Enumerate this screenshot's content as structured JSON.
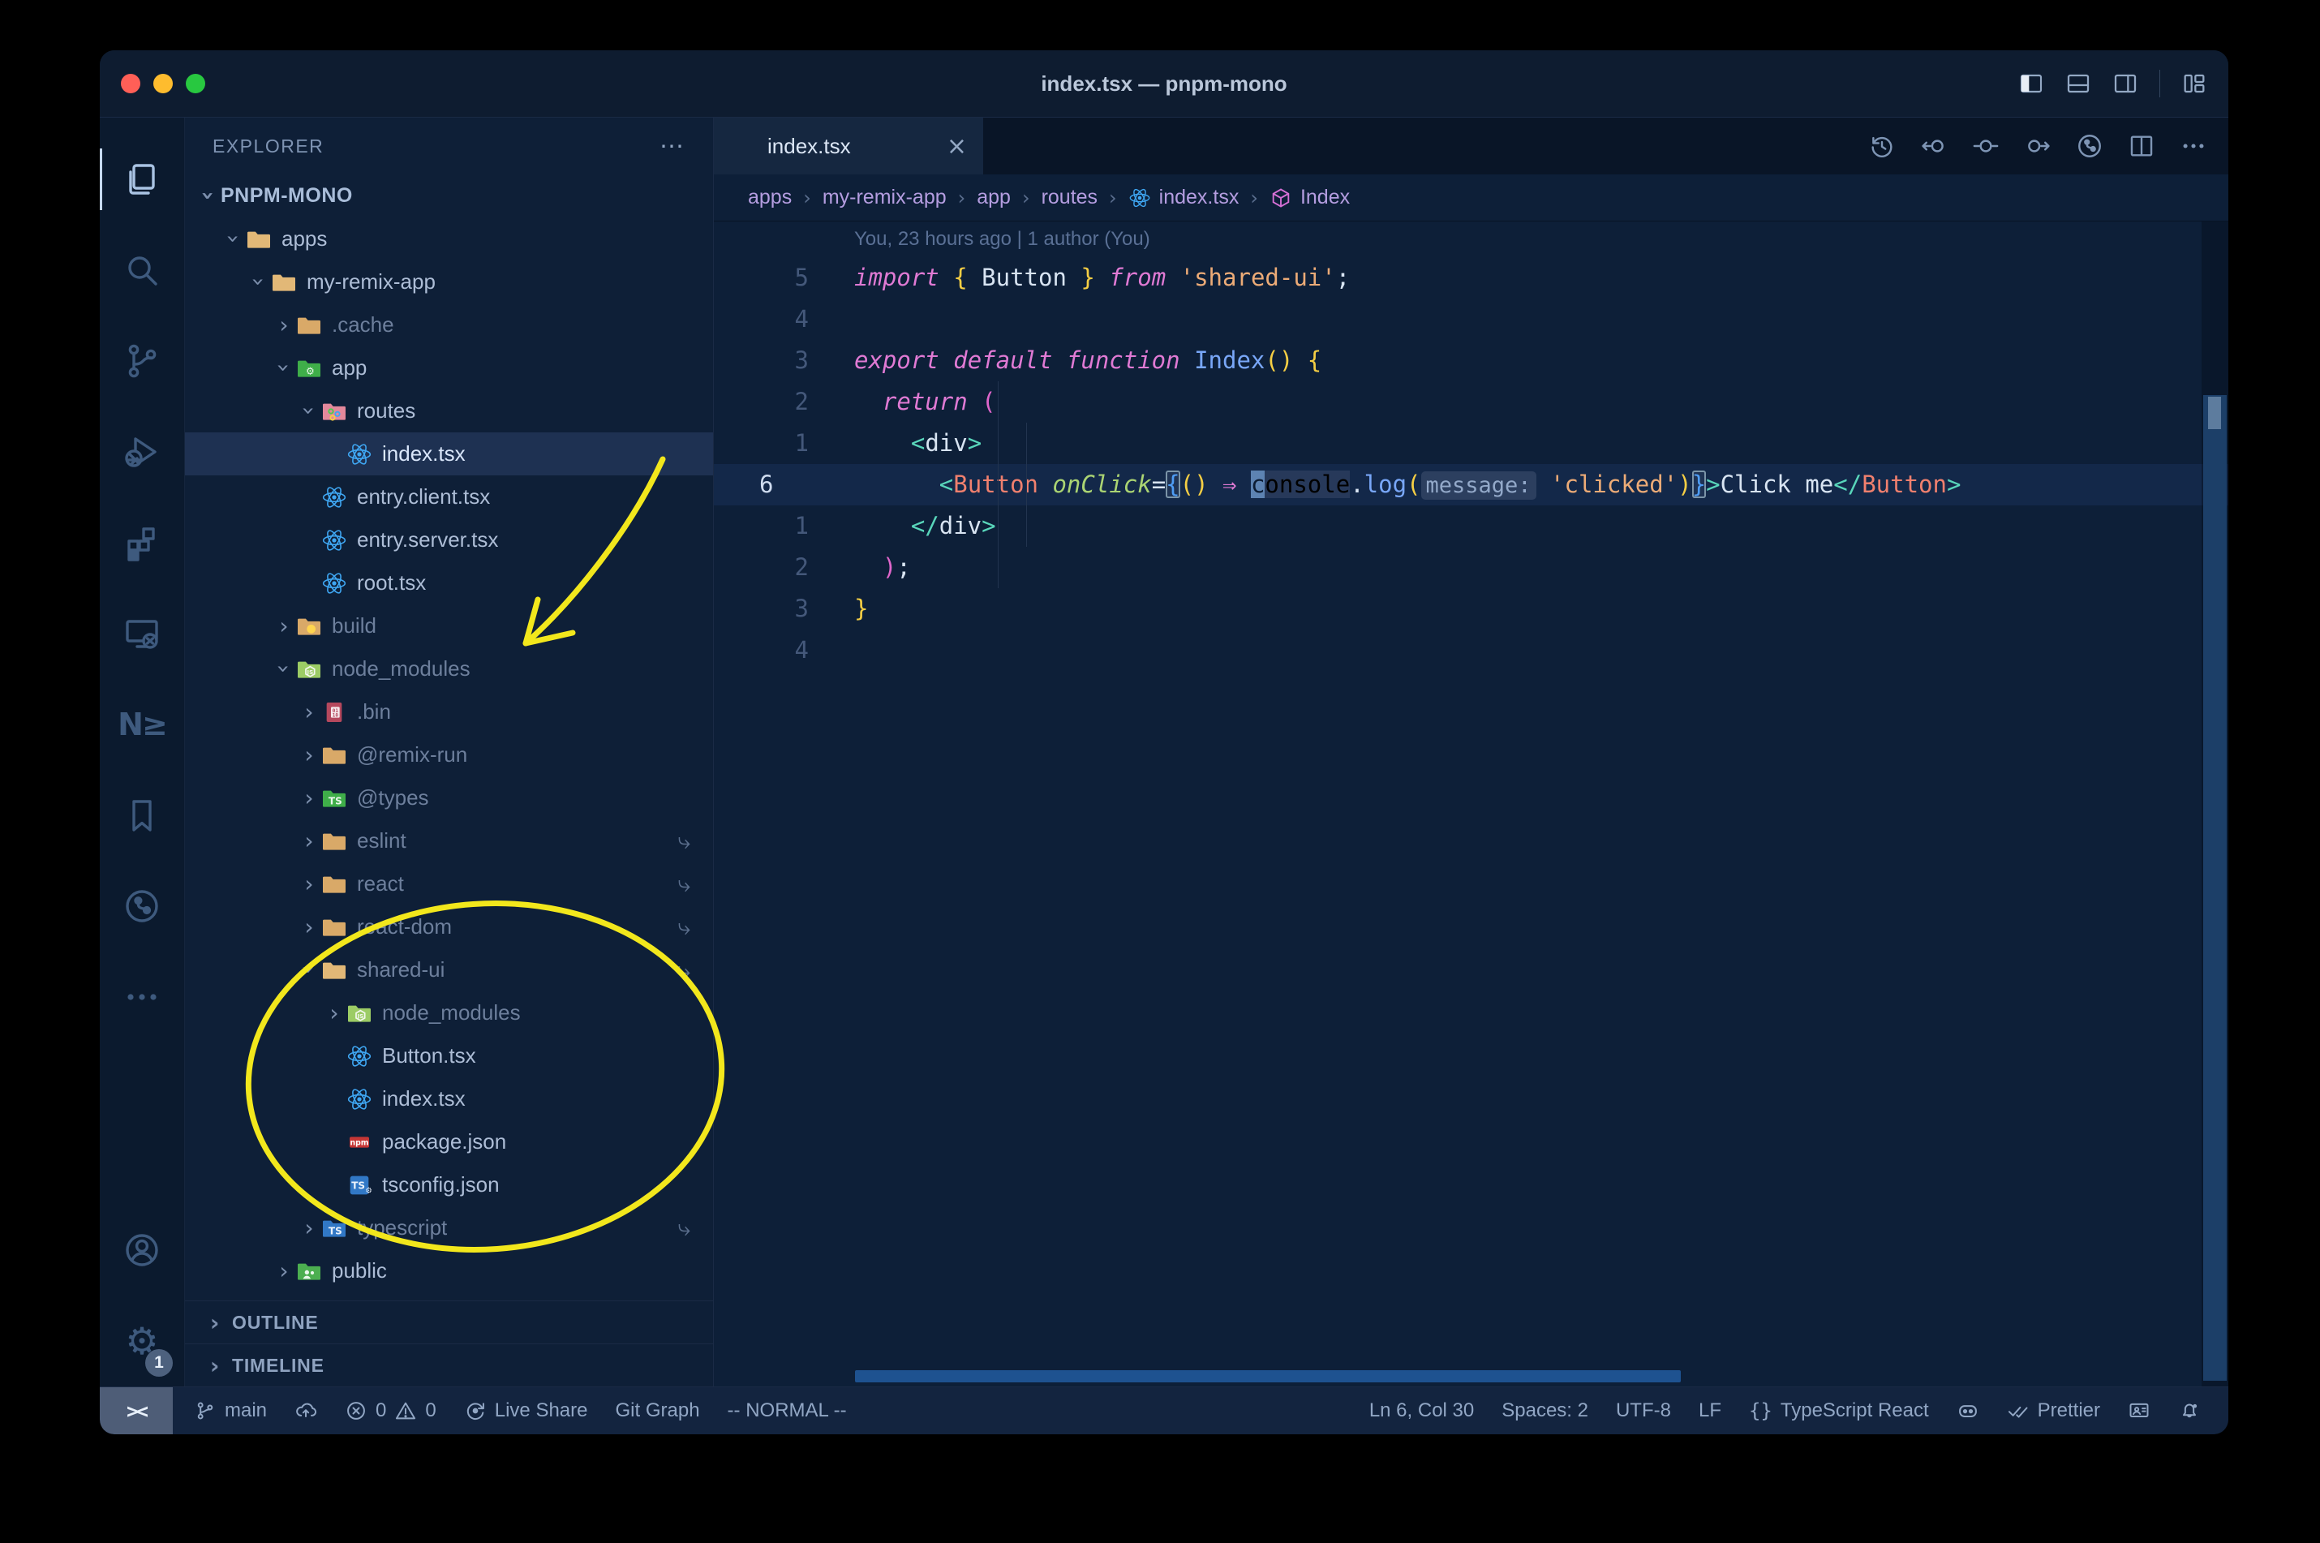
{
  "window": {
    "title": "index.tsx — pnpm-mono"
  },
  "titlebar": {
    "controls": [
      {
        "name": "toggle-primary-sidebar",
        "icon": "layout-sidebar-left"
      },
      {
        "name": "toggle-panel",
        "icon": "layout-panel"
      },
      {
        "name": "toggle-secondary-sidebar",
        "icon": "layout-sidebar-right"
      },
      {
        "name": "customize-layout",
        "icon": "layout-custom"
      }
    ]
  },
  "activity_bar": {
    "top": [
      {
        "name": "explorer",
        "icon": "files",
        "active": true
      },
      {
        "name": "search",
        "icon": "search"
      },
      {
        "name": "source-control",
        "icon": "git-branch-big"
      },
      {
        "name": "run-debug",
        "icon": "debug"
      },
      {
        "name": "extensions",
        "icon": "extensions"
      },
      {
        "name": "remote-explorer",
        "icon": "remote"
      },
      {
        "name": "nx-console",
        "icon": "nx",
        "glyph": "N≥"
      },
      {
        "name": "bookmarks",
        "icon": "bookmark"
      },
      {
        "name": "git-graph",
        "icon": "git-circle"
      },
      {
        "name": "more-views",
        "icon": "ellipsis"
      }
    ],
    "bottom": [
      {
        "name": "accounts",
        "icon": "account"
      },
      {
        "name": "settings",
        "icon": "gear",
        "badge": "1"
      }
    ]
  },
  "sidebar": {
    "header": "EXPLORER",
    "header_more": "⋯",
    "tree": [
      {
        "label": "PNPM-MONO",
        "indent": 0,
        "chevron": "down",
        "root": true
      },
      {
        "label": "apps",
        "indent": 1,
        "chevron": "down",
        "icon": "folder-open"
      },
      {
        "label": "my-remix-app",
        "indent": 2,
        "chevron": "down",
        "icon": "folder-open"
      },
      {
        "label": ".cache",
        "indent": 3,
        "chevron": "right",
        "icon": "folder",
        "dim": true
      },
      {
        "label": "app",
        "indent": 3,
        "chevron": "down",
        "icon": "folder-app"
      },
      {
        "label": "routes",
        "indent": 4,
        "chevron": "down",
        "icon": "folder-routes"
      },
      {
        "label": "index.tsx",
        "indent": 5,
        "icon": "react",
        "selected": true
      },
      {
        "label": "entry.client.tsx",
        "indent": 4,
        "icon": "react"
      },
      {
        "label": "entry.server.tsx",
        "indent": 4,
        "icon": "react"
      },
      {
        "label": "root.tsx",
        "indent": 4,
        "icon": "react"
      },
      {
        "label": "build",
        "indent": 3,
        "chevron": "right",
        "icon": "folder-build",
        "dim": true
      },
      {
        "label": "node_modules",
        "indent": 3,
        "chevron": "down",
        "icon": "folder-node",
        "dim": true
      },
      {
        "label": ".bin",
        "indent": 4,
        "chevron": "right",
        "icon": "file-binary",
        "dim": true
      },
      {
        "label": "@remix-run",
        "indent": 4,
        "chevron": "right",
        "icon": "folder",
        "dim": true
      },
      {
        "label": "@types",
        "indent": 4,
        "chevron": "right",
        "icon": "folder-types",
        "dim": true
      },
      {
        "label": "eslint",
        "indent": 4,
        "chevron": "right",
        "icon": "folder",
        "dim": true,
        "symlink": true
      },
      {
        "label": "react",
        "indent": 4,
        "chevron": "right",
        "icon": "folder",
        "dim": true,
        "symlink": true
      },
      {
        "label": "react-dom",
        "indent": 4,
        "chevron": "right",
        "icon": "folder",
        "dim": true,
        "symlink": true
      },
      {
        "label": "shared-ui",
        "indent": 4,
        "chevron": "down",
        "icon": "folder-open",
        "dim": true,
        "symlink": true
      },
      {
        "label": "node_modules",
        "indent": 5,
        "chevron": "right",
        "icon": "folder-node",
        "dim": true
      },
      {
        "label": "Button.tsx",
        "indent": 5,
        "icon": "react"
      },
      {
        "label": "index.tsx",
        "indent": 5,
        "icon": "react"
      },
      {
        "label": "package.json",
        "indent": 5,
        "icon": "npm"
      },
      {
        "label": "tsconfig.json",
        "indent": 5,
        "icon": "tsconfig"
      },
      {
        "label": "typescript",
        "indent": 4,
        "chevron": "right",
        "icon": "folder-ts",
        "dim": true,
        "symlink": true
      },
      {
        "label": "public",
        "indent": 3,
        "chevron": "right",
        "icon": "folder-public"
      }
    ],
    "bottom_sections": [
      {
        "label": "OUTLINE"
      },
      {
        "label": "TIMELINE"
      }
    ],
    "symlink_glyph": "⤷"
  },
  "editor": {
    "tab": {
      "label": "index.tsx",
      "icon": "react",
      "close": "×"
    },
    "toolbar": [
      {
        "name": "local-history",
        "icon": "history"
      },
      {
        "name": "previous-change",
        "icon": "nav-back"
      },
      {
        "name": "current-change",
        "icon": "nav-dot"
      },
      {
        "name": "next-change",
        "icon": "nav-fwd"
      },
      {
        "name": "git-actions",
        "icon": "git-circle"
      },
      {
        "name": "split-editor",
        "icon": "split"
      },
      {
        "name": "more-actions",
        "icon": "ellipsis"
      }
    ],
    "breadcrumbs": [
      {
        "label": "apps"
      },
      {
        "label": "my-remix-app"
      },
      {
        "label": "app"
      },
      {
        "label": "routes"
      },
      {
        "label": "index.tsx",
        "icon": "react"
      },
      {
        "label": "Index",
        "icon": "symbol-module"
      }
    ],
    "breadcrumb_separator": "›",
    "blame": "You, 23 hours ago | 1 author (You)",
    "code_lines": [
      {
        "num": "5",
        "segs": [
          [
            "kw",
            "import"
          ],
          [
            "pln",
            " "
          ],
          [
            "yb",
            "{"
          ],
          [
            "pln",
            " Button "
          ],
          [
            "yb",
            "}"
          ],
          [
            "pln",
            " "
          ],
          [
            "kw",
            "from"
          ],
          [
            "pln",
            " "
          ],
          [
            "str",
            "'shared-ui'"
          ],
          [
            "pln",
            ";"
          ]
        ]
      },
      {
        "num": "4",
        "segs": []
      },
      {
        "num": "3",
        "segs": [
          [
            "kw",
            "export"
          ],
          [
            "pln",
            " "
          ],
          [
            "kw",
            "default"
          ],
          [
            "pln",
            " "
          ],
          [
            "kw",
            "function"
          ],
          [
            "pln",
            " "
          ],
          [
            "blu",
            "Index"
          ],
          [
            "yb",
            "()"
          ],
          [
            "pln",
            " "
          ],
          [
            "yb",
            "{"
          ]
        ]
      },
      {
        "num": "2",
        "segs": [
          [
            "pln",
            "  "
          ],
          [
            "kw",
            "return"
          ],
          [
            "pln",
            " "
          ],
          [
            "pk",
            "("
          ]
        ]
      },
      {
        "num": "1",
        "segs": [
          [
            "pln",
            "    "
          ],
          [
            "tag",
            "<"
          ],
          [
            "pln",
            "div"
          ],
          [
            "tag",
            ">"
          ]
        ]
      },
      {
        "num": "6",
        "current": true,
        "segs": [
          [
            "pln",
            "      "
          ],
          [
            "tag",
            "<"
          ],
          [
            "comp",
            "Button"
          ],
          [
            "pln",
            " "
          ],
          [
            "attr",
            "onClick"
          ],
          [
            "pln",
            "="
          ],
          [
            "bm",
            "{"
          ],
          [
            "yb",
            "()"
          ],
          [
            "pln",
            " "
          ],
          [
            "arrow",
            "⇒"
          ],
          [
            "pln",
            " "
          ],
          [
            "cursor",
            "c"
          ],
          [
            "hlw",
            "onsole"
          ],
          [
            "pln",
            "."
          ],
          [
            "blu",
            "log"
          ],
          [
            "yb",
            "("
          ],
          [
            "inlay",
            "message:"
          ],
          [
            "pln",
            " "
          ],
          [
            "str",
            "'clicked'"
          ],
          [
            "yb",
            ")"
          ],
          [
            "bm",
            "}"
          ],
          [
            "tag",
            ">"
          ],
          [
            "pln",
            "Click me"
          ],
          [
            "tag",
            "</"
          ],
          [
            "comp",
            "Button"
          ],
          [
            "tag",
            ">"
          ]
        ]
      },
      {
        "num": "1",
        "segs": [
          [
            "pln",
            "    "
          ],
          [
            "tag",
            "</"
          ],
          [
            "pln",
            "div"
          ],
          [
            "tag",
            ">"
          ]
        ]
      },
      {
        "num": "2",
        "segs": [
          [
            "pln",
            "  "
          ],
          [
            "pk",
            ")"
          ],
          [
            "pln",
            ";"
          ]
        ]
      },
      {
        "num": "3",
        "segs": [
          [
            "yb",
            "}"
          ]
        ]
      },
      {
        "num": "4",
        "segs": []
      }
    ]
  },
  "status_bar": {
    "remote_indicator": "><",
    "left": [
      {
        "name": "git-branch",
        "parts": [
          {
            "icon": "git-branch"
          },
          {
            "text": "main"
          }
        ]
      },
      {
        "name": "publish-changes",
        "parts": [
          {
            "icon": "cloud-upload"
          }
        ]
      },
      {
        "name": "problems",
        "parts": [
          {
            "icon": "error"
          },
          {
            "text": "0"
          },
          {
            "icon": "warning"
          },
          {
            "text": "0"
          }
        ]
      },
      {
        "name": "live-share",
        "parts": [
          {
            "icon": "live-share"
          },
          {
            "text": "Live Share"
          }
        ]
      },
      {
        "name": "git-graph",
        "parts": [
          {
            "text": "Git Graph"
          }
        ]
      },
      {
        "name": "vim-mode",
        "parts": [
          {
            "text": "-- NORMAL --"
          }
        ]
      }
    ],
    "right": [
      {
        "name": "cursor-position",
        "parts": [
          {
            "text": "Ln 6, Col 30"
          }
        ]
      },
      {
        "name": "indentation",
        "parts": [
          {
            "text": "Spaces: 2"
          }
        ]
      },
      {
        "name": "encoding",
        "parts": [
          {
            "text": "UTF-8"
          }
        ]
      },
      {
        "name": "eol",
        "parts": [
          {
            "text": "LF"
          }
        ]
      },
      {
        "name": "language-mode",
        "parts": [
          {
            "icon": "braces"
          },
          {
            "text": "TypeScript React"
          }
        ]
      },
      {
        "name": "copilot",
        "parts": [
          {
            "icon": "copilot"
          }
        ]
      },
      {
        "name": "formatter",
        "parts": [
          {
            "icon": "double-check"
          },
          {
            "text": "Prettier"
          }
        ]
      },
      {
        "name": "feedback",
        "parts": [
          {
            "icon": "feedback"
          }
        ]
      },
      {
        "name": "notifications",
        "parts": [
          {
            "icon": "bell"
          }
        ]
      }
    ]
  },
  "annotations": {
    "color": "#f2e71c"
  }
}
